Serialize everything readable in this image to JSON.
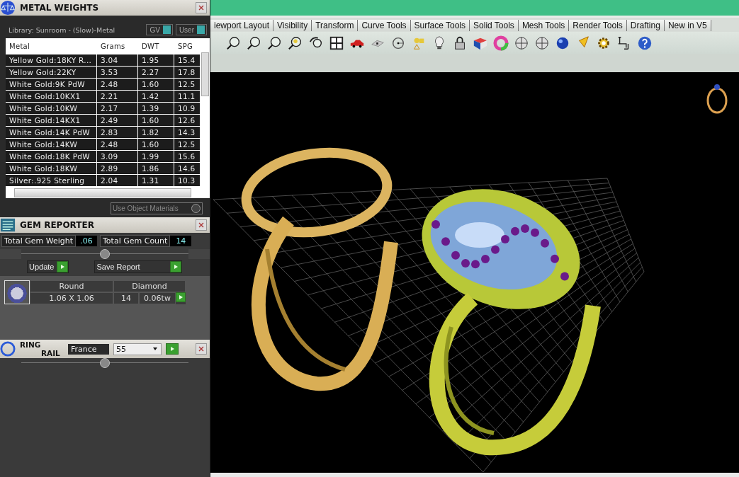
{
  "metal_weights": {
    "title": "METAL WEIGHTS",
    "library": "Library: Sunroom - (Slow)-Metal",
    "toggles": [
      {
        "label": "GV",
        "on": true
      },
      {
        "label": "User",
        "on": true
      }
    ],
    "table": {
      "columns": [
        "Metal",
        "Grams",
        "DWT",
        "SPG"
      ],
      "rows": [
        [
          "Yellow Gold:18KY R...",
          "3.04",
          "1.95",
          "15.4"
        ],
        [
          "Yellow Gold:22KY",
          "3.53",
          "2.27",
          "17.8"
        ],
        [
          "White Gold:9K PdW",
          "2.48",
          "1.60",
          "12.5"
        ],
        [
          "White Gold:10KX1",
          "2.21",
          "1.42",
          "11.1"
        ],
        [
          "White Gold:10KW",
          "2.17",
          "1.39",
          "10.9"
        ],
        [
          "White Gold:14KX1",
          "2.49",
          "1.60",
          "12.6"
        ],
        [
          "White Gold:14K PdW",
          "2.83",
          "1.82",
          "14.3"
        ],
        [
          "White Gold:14KW",
          "2.48",
          "1.60",
          "12.5"
        ],
        [
          "White Gold:18K PdW",
          "3.09",
          "1.99",
          "15.6"
        ],
        [
          "White Gold:18KW",
          "2.89",
          "1.86",
          "14.6"
        ],
        [
          "Silver:.925 Sterling",
          "2.04",
          "1.31",
          "10.3"
        ]
      ]
    },
    "use_object_materials": {
      "label": "Use Object Materials",
      "checked": false
    }
  },
  "gem_reporter": {
    "title": "GEM REPORTER",
    "totals": [
      {
        "label": "Total Gem Weight",
        "value": ".06"
      },
      {
        "label": "Total Gem Count",
        "value": "14"
      }
    ],
    "buttons": [
      "Update",
      "Save Report"
    ],
    "gem": {
      "shape": "Round",
      "material": "Diamond",
      "size": "1.06 X 1.06",
      "count": "14",
      "weight": "0.06tw"
    }
  },
  "ring_rail": {
    "title_lines": [
      "RING",
      "RAIL"
    ],
    "standard": "France",
    "size": "55"
  },
  "tabs": [
    {
      "label": "iewport Layout",
      "selected": false
    },
    {
      "label": "Visibility",
      "selected": false
    },
    {
      "label": "Transform",
      "selected": false
    },
    {
      "label": "Curve Tools",
      "selected": false
    },
    {
      "label": "Surface Tools",
      "selected": false
    },
    {
      "label": "Solid Tools",
      "selected": false
    },
    {
      "label": "Mesh Tools",
      "selected": false
    },
    {
      "label": "Render Tools",
      "selected": false
    },
    {
      "label": "Drafting",
      "selected": false
    },
    {
      "label": "New in V5",
      "selected": false
    }
  ]
}
